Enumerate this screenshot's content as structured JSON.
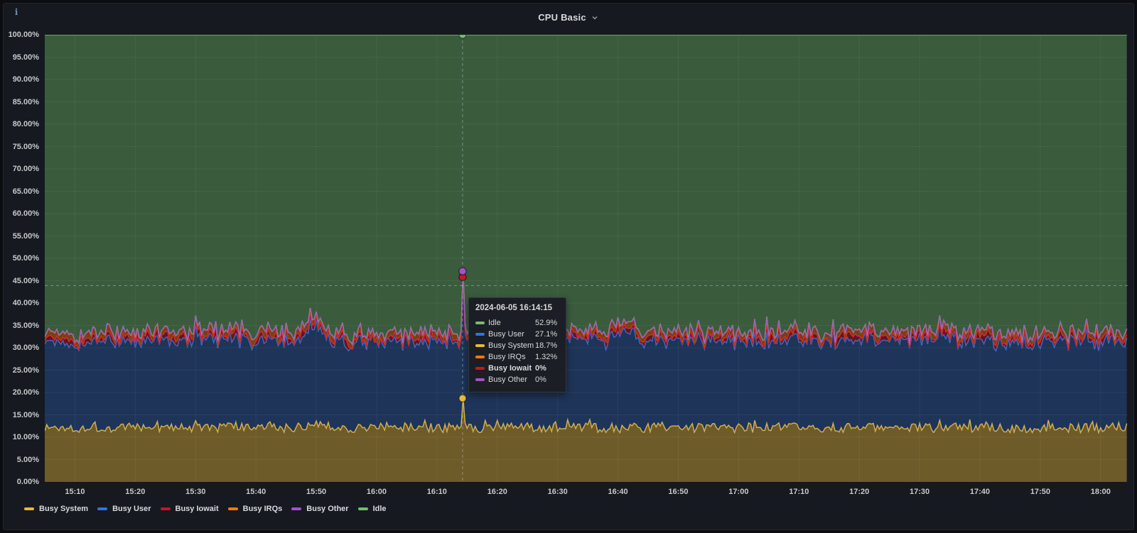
{
  "header": {
    "title": "CPU Basic"
  },
  "icons": {
    "panel_info": "i",
    "title_chevron": "chevron-down"
  },
  "chart_data": {
    "type": "area",
    "stacked": true,
    "unit": "percent",
    "time_start": "15:05:00",
    "time_end": "18:04:30",
    "sample_step_seconds": 20,
    "seed": 1337,
    "ylim": [
      0,
      100
    ],
    "grid": true,
    "y_ticks": [
      [
        0,
        "0.00%"
      ],
      [
        5,
        "5.00%"
      ],
      [
        10,
        "10.00%"
      ],
      [
        15,
        "15.00%"
      ],
      [
        20,
        "20.00%"
      ],
      [
        25,
        "25.00%"
      ],
      [
        30,
        "30.00%"
      ],
      [
        35,
        "35.00%"
      ],
      [
        40,
        "40.00%"
      ],
      [
        45,
        "45.00%"
      ],
      [
        50,
        "50.00%"
      ],
      [
        55,
        "55.00%"
      ],
      [
        60,
        "60.00%"
      ],
      [
        65,
        "65.00%"
      ],
      [
        70,
        "70.00%"
      ],
      [
        75,
        "75.00%"
      ],
      [
        80,
        "80.00%"
      ],
      [
        85,
        "85.00%"
      ],
      [
        90,
        "90.00%"
      ],
      [
        95,
        "95.00%"
      ],
      [
        100,
        "100.00%"
      ]
    ],
    "x_ticks": [
      "15:10",
      "15:20",
      "15:30",
      "15:40",
      "15:50",
      "16:00",
      "16:10",
      "16:20",
      "16:30",
      "16:40",
      "16:50",
      "17:00",
      "17:10",
      "17:20",
      "17:30",
      "17:40",
      "17:50",
      "18:00"
    ],
    "series": [
      {
        "name": "Busy System",
        "color": "#EAB839",
        "fill_opacity": 0.42,
        "baseline": 11.9,
        "noise": 1.1,
        "tooth_prob": 0.08,
        "tooth_amp": 0.9,
        "spike_value": 18.7
      },
      {
        "name": "Busy User",
        "color": "#3274D9",
        "fill_opacity": 0.3,
        "baseline": 19.0,
        "noise": 1.3,
        "tooth_prob": 0.08,
        "tooth_amp": 1.2,
        "spike_value": 27.1
      },
      {
        "name": "Busy Iowait",
        "color": "#C4162A",
        "fill_opacity": 0.42,
        "baseline": 0.55,
        "noise": 0.8,
        "tooth_prob": 0.1,
        "tooth_amp": 0.6,
        "spike_value": 0
      },
      {
        "name": "Busy IRQs",
        "color": "#FF780A",
        "fill_opacity": 0.42,
        "baseline": 1.2,
        "noise": 0.4,
        "tooth_prob": 0.0,
        "tooth_amp": 0,
        "spike_value": 1.32
      },
      {
        "name": "Busy Other",
        "color": "#A352CC",
        "fill_opacity": 0.42,
        "baseline": 0.05,
        "noise": 0.02,
        "tooth_prob": 0.0,
        "tooth_amp": 0,
        "spike_value": 0
      },
      {
        "name": "Idle",
        "color": "#73BF69",
        "fill_opacity": 0.4,
        "remainder": true,
        "spike_value": 52.9
      }
    ],
    "bumps": [
      {
        "time": "15:50:00",
        "width_min": 5,
        "series": "Busy User",
        "extra": 2.6
      },
      {
        "time": "15:50:00",
        "width_min": 5,
        "series": "Busy System",
        "extra": 1.2
      },
      {
        "time": "16:41:00",
        "width_min": 6,
        "series": "Busy User",
        "extra": 1.8
      },
      {
        "time": "17:33:30",
        "width_min": 4,
        "series": "Busy User",
        "extra": 1.6
      }
    ],
    "spike_time": "16:14:15",
    "crosshair": {
      "x_time": "16:14:15",
      "y_value": 43.9
    },
    "highlighted_point": {
      "time": "2024-06-05 16:14:15",
      "values": {
        "Idle": 52.9,
        "Busy User": 27.1,
        "Busy System": 18.7,
        "Busy IRQs": 1.32,
        "Busy Iowait": 0,
        "Busy Other": 0
      }
    }
  },
  "tooltip": {
    "timestamp": "2024-06-05 16:14:15",
    "rows": [
      {
        "label": "Idle",
        "value": "52.9%",
        "color": "#73BF69",
        "bold": false
      },
      {
        "label": "Busy User",
        "value": "27.1%",
        "color": "#3274D9",
        "bold": false
      },
      {
        "label": "Busy System",
        "value": "18.7%",
        "color": "#EAB839",
        "bold": false
      },
      {
        "label": "Busy IRQs",
        "value": "1.32%",
        "color": "#FF780A",
        "bold": false
      },
      {
        "label": "Busy Iowait",
        "value": "0%",
        "color": "#C4162A",
        "bold": true
      },
      {
        "label": "Busy Other",
        "value": "0%",
        "color": "#A352CC",
        "bold": false
      }
    ]
  },
  "legend": {
    "items": [
      {
        "label": "Busy System",
        "color": "#EAB839"
      },
      {
        "label": "Busy User",
        "color": "#3274D9"
      },
      {
        "label": "Busy Iowait",
        "color": "#C4162A"
      },
      {
        "label": "Busy IRQs",
        "color": "#FF780A"
      },
      {
        "label": "Busy Other",
        "color": "#A352CC"
      },
      {
        "label": "Idle",
        "color": "#73BF69"
      }
    ]
  },
  "colors": {
    "background": "#161920",
    "grid": "rgba(255,255,255,0.07)",
    "axis_text": "#c7c8c9",
    "crosshair": "rgba(170,180,192,0.6)"
  }
}
